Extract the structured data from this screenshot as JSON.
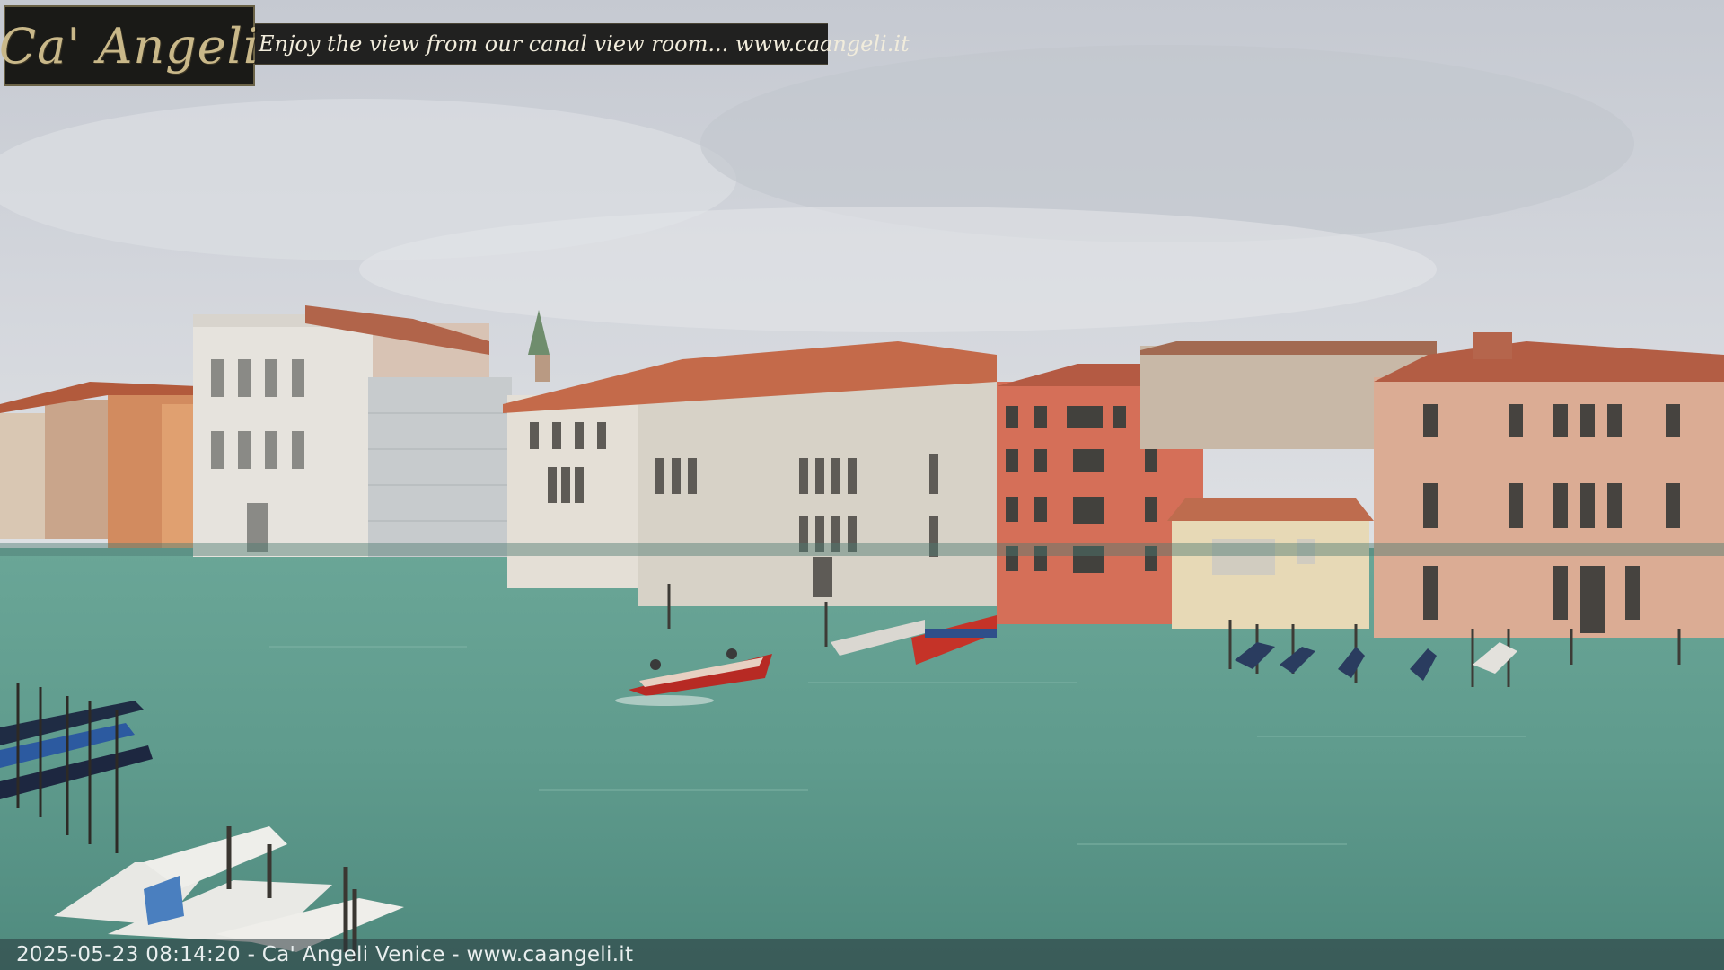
{
  "overlay": {
    "logo_text": "Ca' Angeli",
    "tagline": "Enjoy the view from our canal view room... www.caangeli.it",
    "timestamp_caption": "2025-05-23 08:14:20 - Ca' Angeli Venice - www.caangeli.it"
  },
  "colors": {
    "sky": "#cdd1d8",
    "water": "#5f9c8f",
    "logo_gold": "#c9b889",
    "tagline_bg": "#121210"
  }
}
